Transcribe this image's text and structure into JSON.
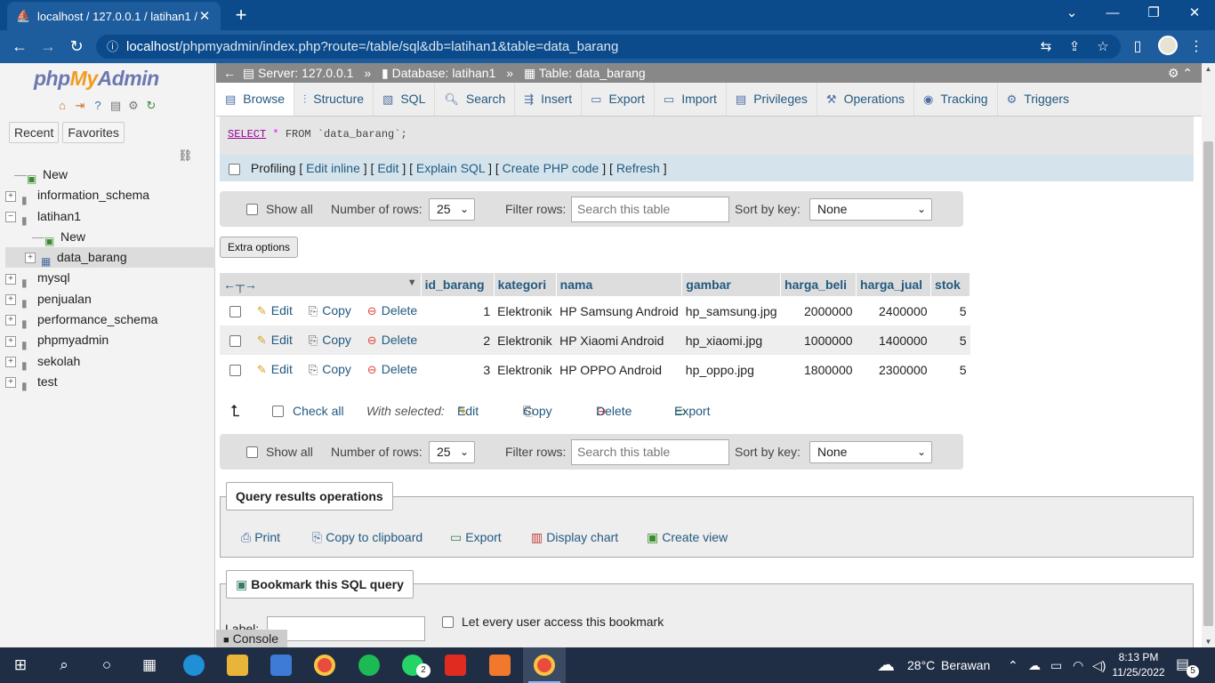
{
  "browser": {
    "tab_title": "localhost / 127.0.0.1 / latihan1 / d",
    "url_host": "localhost",
    "url_path": "/phpmyadmin/index.php?route=/table/sql&db=latihan1&table=data_barang"
  },
  "sidebar": {
    "logo_php": "php",
    "logo_my": "My",
    "logo_admin": "Admin",
    "tab_recent": "Recent",
    "tab_favorites": "Favorites",
    "tree": [
      {
        "label": "New"
      },
      {
        "label": "information_schema"
      },
      {
        "label": "latihan1"
      },
      {
        "label": "New"
      },
      {
        "label": "data_barang"
      },
      {
        "label": "mysql"
      },
      {
        "label": "penjualan"
      },
      {
        "label": "performance_schema"
      },
      {
        "label": "phpmyadmin"
      },
      {
        "label": "sekolah"
      },
      {
        "label": "test"
      }
    ]
  },
  "breadcrumb": {
    "server": "Server: 127.0.0.1",
    "database": "Database: latihan1",
    "table": "Table: data_barang"
  },
  "menu": [
    "Browse",
    "Structure",
    "SQL",
    "Search",
    "Insert",
    "Export",
    "Import",
    "Privileges",
    "Operations",
    "Tracking",
    "Triggers"
  ],
  "sql": {
    "select": "SELECT",
    "star": "*",
    "from": "FROM",
    "table": "`data_barang`;"
  },
  "profiling": {
    "label": "Profiling",
    "edit_inline": "Edit inline",
    "edit": "Edit",
    "explain": "Explain SQL",
    "php_code": "Create PHP code",
    "refresh": "Refresh"
  },
  "nav": {
    "show_all": "Show all",
    "number_of_rows_label": "Number of rows:",
    "number_of_rows": "25",
    "filter_label": "Filter rows:",
    "filter_placeholder": "Search this table",
    "sort_label": "Sort by key:",
    "sort_value": "None"
  },
  "extra_options": "Extra options",
  "table": {
    "columns": [
      "id_barang",
      "kategori",
      "nama",
      "gambar",
      "harga_beli",
      "harga_jual",
      "stok"
    ],
    "action_edit": "Edit",
    "action_copy": "Copy",
    "action_delete": "Delete",
    "rows": [
      {
        "id_barang": "1",
        "kategori": "Elektronik",
        "nama": "HP Samsung Android",
        "gambar": "hp_samsung.jpg",
        "harga_beli": "2000000",
        "harga_jual": "2400000",
        "stok": "5"
      },
      {
        "id_barang": "2",
        "kategori": "Elektronik",
        "nama": "HP Xiaomi Android",
        "gambar": "hp_xiaomi.jpg",
        "harga_beli": "1000000",
        "harga_jual": "1400000",
        "stok": "5"
      },
      {
        "id_barang": "3",
        "kategori": "Elektronik",
        "nama": "HP OPPO Android",
        "gambar": "hp_oppo.jpg",
        "harga_beli": "1800000",
        "harga_jual": "2300000",
        "stok": "5"
      }
    ]
  },
  "bulk": {
    "check_all": "Check all",
    "with_selected": "With selected:",
    "edit": "Edit",
    "copy": "Copy",
    "delete": "Delete",
    "export": "Export"
  },
  "query_ops": {
    "legend": "Query results operations",
    "print": "Print",
    "copy_clipboard": "Copy to clipboard",
    "export": "Export",
    "display_chart": "Display chart",
    "create_view": "Create view"
  },
  "bookmark": {
    "legend": "Bookmark this SQL query",
    "label": "Label:",
    "every_user": "Let every user access this bookmark"
  },
  "console_label": "Console",
  "taskbar": {
    "weather_temp": "28°C",
    "weather_text": "Berawan",
    "time": "8:13 PM",
    "date": "11/25/2022",
    "notif_count": "5",
    "whatsapp_badge": "2"
  },
  "colors": {
    "link": "#235a81",
    "chrome_blue": "#0b4a8b",
    "taskbar": "#1f2e45"
  }
}
